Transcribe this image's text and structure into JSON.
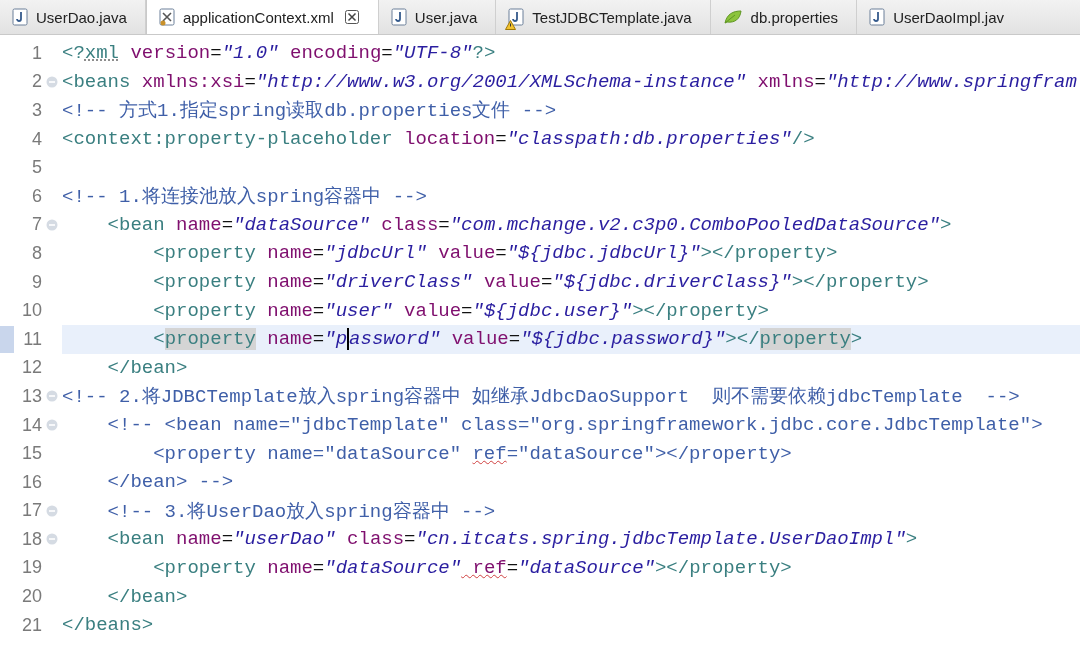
{
  "tabs": [
    {
      "label": "UserDao.java",
      "kind": "java",
      "warning": false,
      "selected": false
    },
    {
      "label": "applicationContext.xml",
      "kind": "xml",
      "warning": false,
      "selected": true
    },
    {
      "label": "User.java",
      "kind": "java",
      "warning": false,
      "selected": false
    },
    {
      "label": "TestJDBCTemplate.java",
      "kind": "java",
      "warning": true,
      "selected": false
    },
    {
      "label": "db.properties",
      "kind": "properties",
      "warning": false,
      "selected": false
    },
    {
      "label": "UserDaoImpl.jav",
      "kind": "java",
      "warning": false,
      "selected": false
    }
  ],
  "editor": {
    "lines": [
      {
        "number": "1",
        "foldable": false,
        "current": false,
        "tokens": [
          {
            "kind": "tag",
            "text": "<?"
          },
          {
            "kind": "tag",
            "text": "xml",
            "misspelled": true
          },
          {
            "kind": "attr",
            "text": " version"
          },
          {
            "kind": "text",
            "text": "="
          },
          {
            "kind": "value",
            "text": "\"1.0\""
          },
          {
            "kind": "attr",
            "text": " encoding"
          },
          {
            "kind": "text",
            "text": "="
          },
          {
            "kind": "value",
            "text": "\"UTF-8\""
          },
          {
            "kind": "tag",
            "text": "?>"
          }
        ]
      },
      {
        "number": "2",
        "foldable": true,
        "current": false,
        "tokens": [
          {
            "kind": "tag",
            "text": "<beans"
          },
          {
            "kind": "attr",
            "text": " xmlns:xsi"
          },
          {
            "kind": "text",
            "text": "="
          },
          {
            "kind": "value",
            "text": "\"http://www.w3.org/2001/XMLSchema-instance\""
          },
          {
            "kind": "attr",
            "text": " xmlns"
          },
          {
            "kind": "text",
            "text": "="
          },
          {
            "kind": "value",
            "text": "\"http://www.springfram"
          }
        ]
      },
      {
        "number": "3",
        "foldable": false,
        "current": false,
        "tokens": [
          {
            "kind": "comment",
            "text": "<!-- 方式1.指定spring读取db.properties文件 -->"
          }
        ]
      },
      {
        "number": "4",
        "foldable": false,
        "current": false,
        "tokens": [
          {
            "kind": "tag",
            "text": "<context:property-placeholder"
          },
          {
            "kind": "attr",
            "text": " location"
          },
          {
            "kind": "text",
            "text": "="
          },
          {
            "kind": "value",
            "text": "\"classpath:db.properties\""
          },
          {
            "kind": "tag",
            "text": "/>"
          }
        ]
      },
      {
        "number": "5",
        "foldable": false,
        "current": false
      },
      {
        "number": "6",
        "foldable": false,
        "current": false,
        "tokens": [
          {
            "kind": "comment",
            "text": "<!-- 1.将连接池放入spring容器中 -->"
          }
        ]
      },
      {
        "number": "7",
        "foldable": true,
        "current": false,
        "tokens": [
          {
            "kind": "tag",
            "text": "    <bean"
          },
          {
            "kind": "attr",
            "text": " name"
          },
          {
            "kind": "text",
            "text": "="
          },
          {
            "kind": "value",
            "text": "\"dataSource\""
          },
          {
            "kind": "attr",
            "text": " class"
          },
          {
            "kind": "text",
            "text": "="
          },
          {
            "kind": "value",
            "text": "\"com.mchange.v2.c3p0.ComboPooledDataSource\""
          },
          {
            "kind": "tag",
            "text": ">"
          }
        ]
      },
      {
        "number": "8",
        "foldable": false,
        "current": false,
        "tokens": [
          {
            "kind": "tag",
            "text": "        <property"
          },
          {
            "kind": "attr",
            "text": " name"
          },
          {
            "kind": "text",
            "text": "="
          },
          {
            "kind": "value",
            "text": "\"jdbcUrl\""
          },
          {
            "kind": "attr",
            "text": " value"
          },
          {
            "kind": "text",
            "text": "="
          },
          {
            "kind": "value",
            "text": "\"${jdbc.jdbcUrl}\""
          },
          {
            "kind": "tag",
            "text": "></property>"
          }
        ]
      },
      {
        "number": "9",
        "foldable": false,
        "current": false,
        "tokens": [
          {
            "kind": "tag",
            "text": "        <property"
          },
          {
            "kind": "attr",
            "text": " name"
          },
          {
            "kind": "text",
            "text": "="
          },
          {
            "kind": "value",
            "text": "\"driverClass\""
          },
          {
            "kind": "attr",
            "text": " value"
          },
          {
            "kind": "text",
            "text": "="
          },
          {
            "kind": "value",
            "text": "\"${jdbc.driverClass}\""
          },
          {
            "kind": "tag",
            "text": "></property>"
          }
        ]
      },
      {
        "number": "10",
        "foldable": false,
        "current": false,
        "tokens": [
          {
            "kind": "tag",
            "text": "        <property"
          },
          {
            "kind": "attr",
            "text": " name"
          },
          {
            "kind": "text",
            "text": "="
          },
          {
            "kind": "value",
            "text": "\"user\""
          },
          {
            "kind": "attr",
            "text": " value"
          },
          {
            "kind": "text",
            "text": "="
          },
          {
            "kind": "value",
            "text": "\"${jdbc.user}\""
          },
          {
            "kind": "tag",
            "text": "></property>"
          }
        ]
      },
      {
        "number": "11",
        "foldable": false,
        "current": true,
        "tokens": [
          {
            "kind": "tag",
            "text": "        <"
          },
          {
            "kind": "tag",
            "text": "property",
            "occurrence": true
          },
          {
            "kind": "attr",
            "text": " name"
          },
          {
            "kind": "text",
            "text": "="
          },
          {
            "kind": "value",
            "text": "\"p"
          },
          {
            "kind": "value",
            "text": "assword\"",
            "caret": true
          },
          {
            "kind": "attr",
            "text": " value"
          },
          {
            "kind": "text",
            "text": "="
          },
          {
            "kind": "value",
            "text": "\"${jdbc.password}\""
          },
          {
            "kind": "tag",
            "text": "></"
          },
          {
            "kind": "tag",
            "text": "property",
            "occurrence": true
          },
          {
            "kind": "tag",
            "text": ">"
          }
        ]
      },
      {
        "number": "12",
        "foldable": false,
        "current": false,
        "tokens": [
          {
            "kind": "tag",
            "text": "    </bean>"
          }
        ]
      },
      {
        "number": "13",
        "foldable": true,
        "current": false,
        "tokens": [
          {
            "kind": "comment",
            "text": "<!-- 2.将JDBCTemplate放入spring容器中 如继承JdbcDaoSupport  则不需要依赖jdbcTemplate  -->"
          }
        ]
      },
      {
        "number": "14",
        "foldable": true,
        "current": false,
        "tokens": [
          {
            "kind": "comment",
            "text": "    <!-- <bean name=\"jdbcTemplate\" class=\"org.springframework.jdbc.core.JdbcTemplate\">"
          }
        ]
      },
      {
        "number": "15",
        "foldable": false,
        "current": false,
        "tokens": [
          {
            "kind": "comment",
            "text": "        <property name=\"dataSource\" "
          },
          {
            "kind": "comment",
            "text": "ref",
            "misspelled": true
          },
          {
            "kind": "comment",
            "text": "=\"dataSource\"></property>"
          }
        ]
      },
      {
        "number": "16",
        "foldable": false,
        "current": false,
        "tokens": [
          {
            "kind": "comment",
            "text": "    </bean> -->"
          }
        ]
      },
      {
        "number": "17",
        "foldable": true,
        "current": false,
        "tokens": [
          {
            "kind": "comment",
            "text": "    <!-- 3.将UserDao放入spring容器中 -->"
          }
        ]
      },
      {
        "number": "18",
        "foldable": true,
        "current": false,
        "tokens": [
          {
            "kind": "tag",
            "text": "    <bean"
          },
          {
            "kind": "attr",
            "text": " name"
          },
          {
            "kind": "text",
            "text": "="
          },
          {
            "kind": "value",
            "text": "\"userDao\""
          },
          {
            "kind": "attr",
            "text": " class"
          },
          {
            "kind": "text",
            "text": "="
          },
          {
            "kind": "value",
            "text": "\"cn.itcats.spring.jdbcTemplate.UserDaoImpl\""
          },
          {
            "kind": "tag",
            "text": ">"
          }
        ]
      },
      {
        "number": "19",
        "foldable": false,
        "current": false,
        "tokens": [
          {
            "kind": "tag",
            "text": "        <property"
          },
          {
            "kind": "attr",
            "text": " name"
          },
          {
            "kind": "text",
            "text": "="
          },
          {
            "kind": "value",
            "text": "\"dataSource\""
          },
          {
            "kind": "attr",
            "text": " ref",
            "misspelled": true
          },
          {
            "kind": "text",
            "text": "="
          },
          {
            "kind": "value",
            "text": "\"dataSource\""
          },
          {
            "kind": "tag",
            "text": "></property>"
          }
        ]
      },
      {
        "number": "20",
        "foldable": false,
        "current": false,
        "tokens": [
          {
            "kind": "tag",
            "text": "    </bean>"
          }
        ]
      },
      {
        "number": "21",
        "foldable": false,
        "current": false,
        "tokens": [
          {
            "kind": "tag",
            "text": "</beans>"
          }
        ]
      }
    ]
  }
}
